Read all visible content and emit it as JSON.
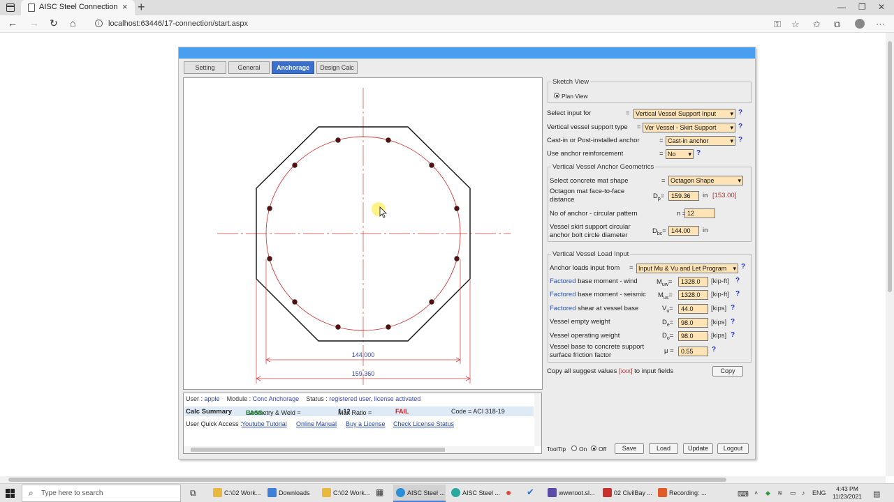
{
  "browser": {
    "tab_title": "AISC Steel Connection Design Sc",
    "url": "localhost:63446/17-connection/start.aspx"
  },
  "app": {
    "tabs": [
      "Setting",
      "General",
      "Anchorage",
      "Design Calc"
    ],
    "active_tab": "Anchorage",
    "header_color": "#4a9ef0"
  },
  "sketch": {
    "dim_inner": "144.000",
    "dim_outer": "159.360"
  },
  "status": {
    "user_label": "User :",
    "user": "apple",
    "module_label": "Module :",
    "module": "Conc Anchorage",
    "status_label": "Status :",
    "status_value": "registered user, license activated",
    "calc_summary": "Calc Summary",
    "geometry": "Geometry & Weld = ",
    "pass": "PASS",
    "max_ratio_label": "Max Ratio = ",
    "max_ratio": "1.12",
    "fail": "FAIL",
    "code": "Code = ACI 318-19",
    "quick_access": "User Quick Access :",
    "links": [
      "Youtube Tutorial",
      "Online Manual",
      "Buy a License",
      "Check License Status"
    ]
  },
  "sketch_view": {
    "legend": "Sketch View",
    "option": "Plan View"
  },
  "inputs": {
    "select_input_for": {
      "label": "Select input for",
      "value": "Vertical Vessel Support Input"
    },
    "support_type": {
      "label": "Vertical vessel support type",
      "value": "Ver Vessel - Skirt Support"
    },
    "cast_in": {
      "label": "Cast-in or Post-installed anchor",
      "value": "Cast-in anchor"
    },
    "reinforcement": {
      "label": "Use anchor reinforcement",
      "value": "No"
    }
  },
  "geometry": {
    "legend": "Vertical Vessel Anchor Geometrics",
    "mat_shape": {
      "label": "Select concrete mat shape",
      "value": "Octagon Shape"
    },
    "face_dist": {
      "label1": "Octagon mat face-to-face",
      "label2": "distance",
      "sym": "D",
      "sub": "p",
      "value": "159.36",
      "unit": "in",
      "suggest": "[153.00]"
    },
    "n_anchor": {
      "label": "No of anchor - circular pattern",
      "sym": "n",
      "value": "12"
    },
    "bolt_circle": {
      "label1": "Vessel skirt support circular",
      "label2": "anchor bolt circle diameter",
      "sym": "D",
      "sub": "bc",
      "value": "144.00",
      "unit": "in"
    }
  },
  "loads": {
    "legend": "Vertical Vessel Load Input",
    "anchor_loads": {
      "label": "Anchor loads input from",
      "value": "Input Mu & Vu and Let Program"
    },
    "rows": [
      {
        "pre": "Factored",
        "label": " base moment - wind",
        "sym": "M",
        "sub": "uw",
        "value": "1328.0",
        "unit": "[kip-ft]"
      },
      {
        "pre": "Factored",
        "label": " base moment - seismic",
        "sym": "M",
        "sub": "us",
        "value": "1328.0",
        "unit": "[kip-ft]"
      },
      {
        "pre": "Factored",
        "label": " shear at vessel base",
        "sym": "V",
        "sub": "u",
        "value": "44.0",
        "unit": "[kips]"
      },
      {
        "pre": "",
        "label": "Vessel empty weight",
        "sym": "D",
        "sub": "e",
        "value": "98.0",
        "unit": "[kips]"
      },
      {
        "pre": "",
        "label": "Vessel operating weight",
        "sym": "D",
        "sub": "o",
        "value": "98.0",
        "unit": "[kips]"
      }
    ],
    "friction": {
      "label1": "Vessel base to concrete support",
      "label2": "surface friction factor",
      "sym": "μ",
      "value": "0.55"
    }
  },
  "copy": {
    "text_pre": "Copy all suggest values ",
    "text_mid": "[xxx]",
    "text_post": " to input fields",
    "button": "Copy"
  },
  "footer": {
    "tooltip": "ToolTip",
    "on": "On",
    "off": "Off",
    "buttons": [
      "Save",
      "Load",
      "Update",
      "Logout"
    ]
  },
  "taskbar": {
    "search": "Type here to search",
    "apps": [
      "C:\\02 Work...",
      "Downloads",
      "C:\\02 Work...",
      "AISC Steel ...",
      "AISC Steel ...",
      "wwwroot.sl...",
      "02 CivilBay ...",
      "Recording: ..."
    ],
    "lang": "ENG",
    "time": "4:43 PM",
    "date": "11/23/2021"
  }
}
